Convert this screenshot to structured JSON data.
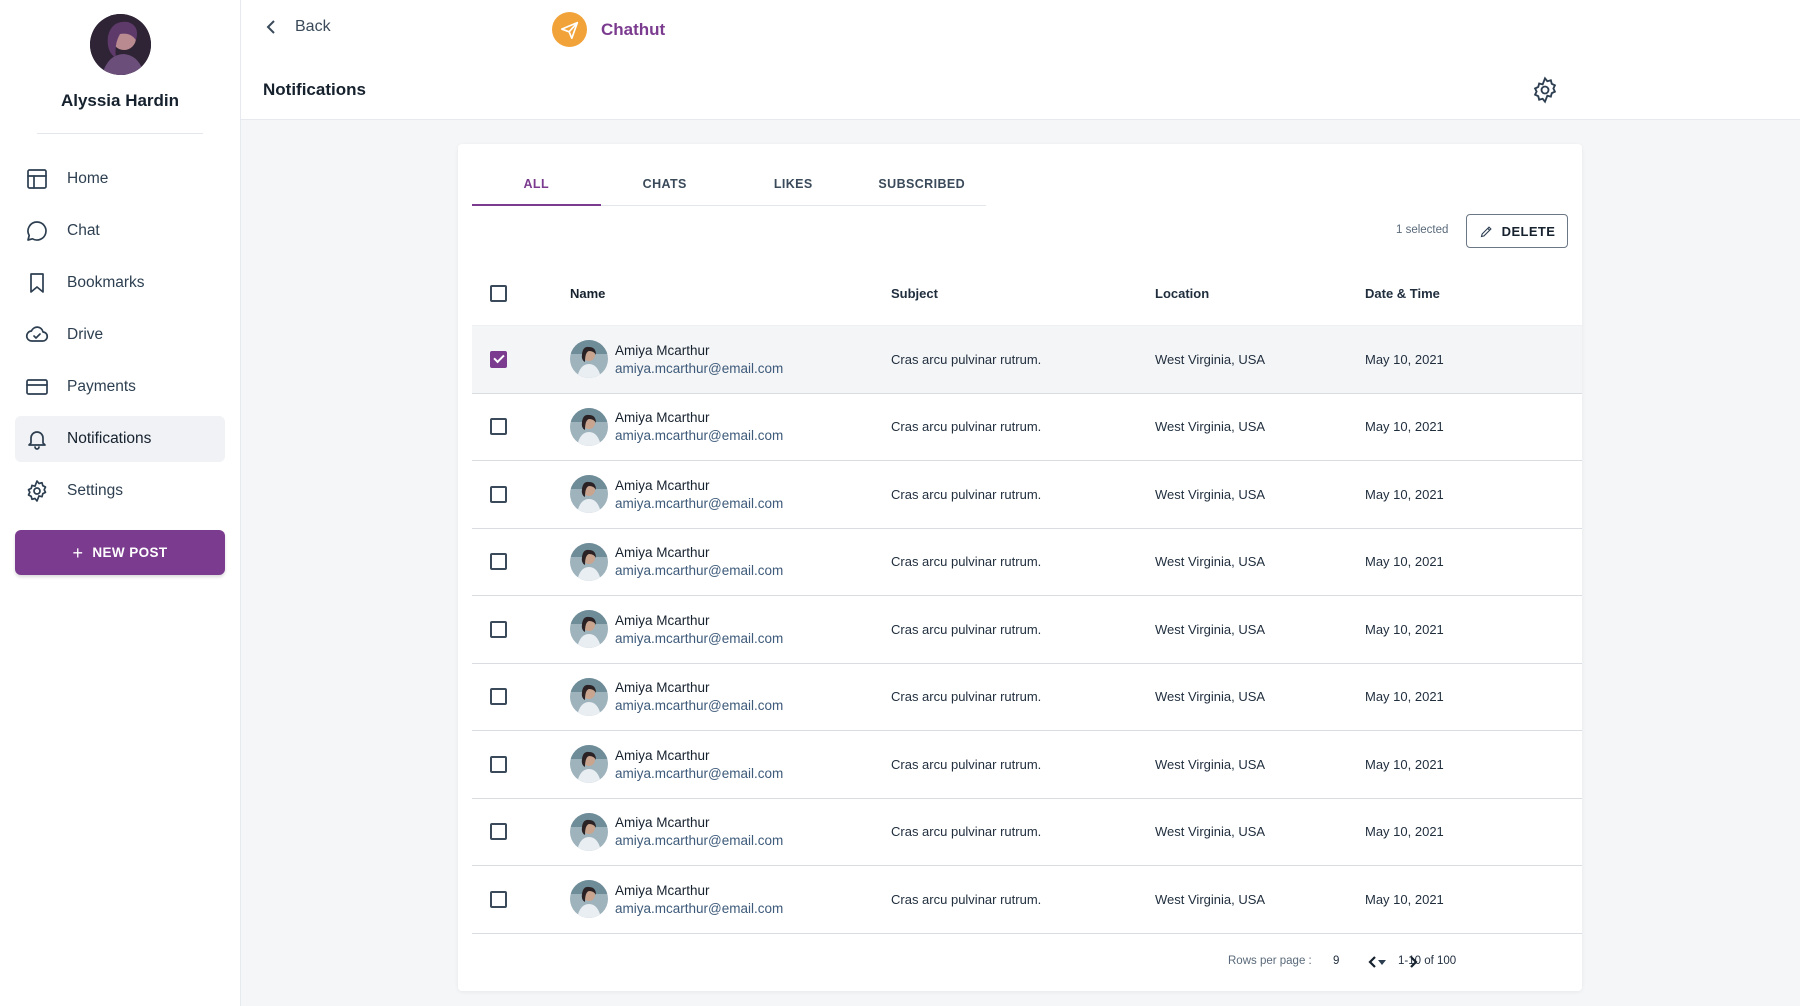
{
  "user": {
    "name": "Alyssia Hardin"
  },
  "sidebar": {
    "items": [
      {
        "label": "Home",
        "icon": "layout-icon",
        "active": false
      },
      {
        "label": "Chat",
        "icon": "chat-icon",
        "active": false
      },
      {
        "label": "Bookmarks",
        "icon": "bookmark-icon",
        "active": false
      },
      {
        "label": "Drive",
        "icon": "cloud-icon",
        "active": false
      },
      {
        "label": "Payments",
        "icon": "credit-card-icon",
        "active": false
      },
      {
        "label": "Notifications",
        "icon": "bell-icon",
        "active": true
      },
      {
        "label": "Settings",
        "icon": "gear-icon",
        "active": false
      }
    ],
    "new_post_label": "NEW POST"
  },
  "header": {
    "back_label": "Back",
    "brand_name": "Chathut",
    "page_title": "Notifications"
  },
  "colors": {
    "accent": "#7b3b8f",
    "brand_logo": "#f1a33a"
  },
  "tabs": [
    {
      "label": "ALL",
      "active": true
    },
    {
      "label": "CHATS",
      "active": false
    },
    {
      "label": "LIKES",
      "active": false
    },
    {
      "label": "SUBSCRIBED",
      "active": false
    }
  ],
  "toolbar": {
    "selected_text": "1 selected",
    "delete_label": "DELETE"
  },
  "table": {
    "columns": [
      "Name",
      "Subject",
      "Location",
      "Date & Time"
    ],
    "rows": [
      {
        "checked": true,
        "name": "Amiya Mcarthur",
        "email": "amiya.mcarthur@email.com",
        "subject": "Cras arcu pulvinar rutrum.",
        "location": "West Virginia, USA",
        "date": "May 10, 2021"
      },
      {
        "checked": false,
        "name": "Amiya Mcarthur",
        "email": "amiya.mcarthur@email.com",
        "subject": "Cras arcu pulvinar rutrum.",
        "location": "West Virginia, USA",
        "date": "May 10, 2021"
      },
      {
        "checked": false,
        "name": "Amiya Mcarthur",
        "email": "amiya.mcarthur@email.com",
        "subject": "Cras arcu pulvinar rutrum.",
        "location": "West Virginia, USA",
        "date": "May 10, 2021"
      },
      {
        "checked": false,
        "name": "Amiya Mcarthur",
        "email": "amiya.mcarthur@email.com",
        "subject": "Cras arcu pulvinar rutrum.",
        "location": "West Virginia, USA",
        "date": "May 10, 2021"
      },
      {
        "checked": false,
        "name": "Amiya Mcarthur",
        "email": "amiya.mcarthur@email.com",
        "subject": "Cras arcu pulvinar rutrum.",
        "location": "West Virginia, USA",
        "date": "May 10, 2021"
      },
      {
        "checked": false,
        "name": "Amiya Mcarthur",
        "email": "amiya.mcarthur@email.com",
        "subject": "Cras arcu pulvinar rutrum.",
        "location": "West Virginia, USA",
        "date": "May 10, 2021"
      },
      {
        "checked": false,
        "name": "Amiya Mcarthur",
        "email": "amiya.mcarthur@email.com",
        "subject": "Cras arcu pulvinar rutrum.",
        "location": "West Virginia, USA",
        "date": "May 10, 2021"
      },
      {
        "checked": false,
        "name": "Amiya Mcarthur",
        "email": "amiya.mcarthur@email.com",
        "subject": "Cras arcu pulvinar rutrum.",
        "location": "West Virginia, USA",
        "date": "May 10, 2021"
      },
      {
        "checked": false,
        "name": "Amiya Mcarthur",
        "email": "amiya.mcarthur@email.com",
        "subject": "Cras arcu pulvinar rutrum.",
        "location": "West Virginia, USA",
        "date": "May 10, 2021"
      }
    ]
  },
  "pagination": {
    "rows_per_page_label": "Rows per page :",
    "rows_per_page_value": "9",
    "range_text": "1-10 of 100"
  }
}
